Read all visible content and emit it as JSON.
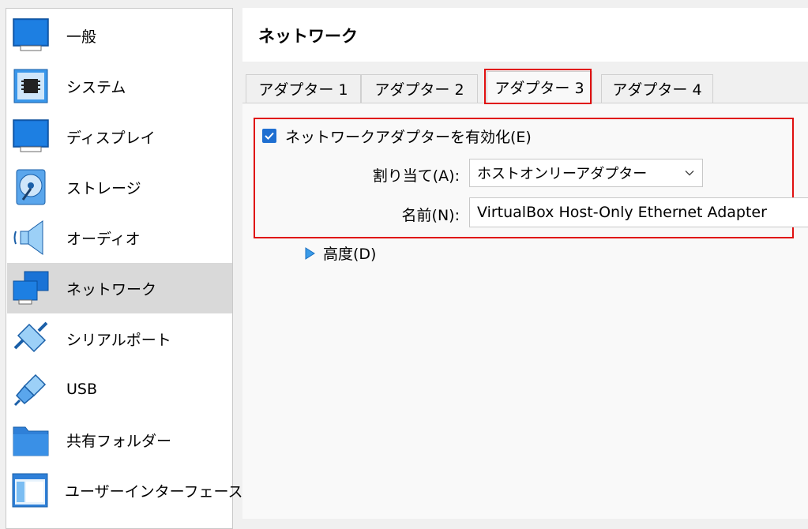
{
  "sidebar": {
    "items": [
      {
        "label": "一般",
        "icon": "general-icon"
      },
      {
        "label": "システム",
        "icon": "system-chip-icon"
      },
      {
        "label": "ディスプレイ",
        "icon": "display-monitor-icon"
      },
      {
        "label": "ストレージ",
        "icon": "storage-disk-icon"
      },
      {
        "label": "オーディオ",
        "icon": "audio-speaker-icon"
      },
      {
        "label": "ネットワーク",
        "icon": "network-icon"
      },
      {
        "label": "シリアルポート",
        "icon": "serial-port-icon"
      },
      {
        "label": "USB",
        "icon": "usb-icon"
      },
      {
        "label": "共有フォルダー",
        "icon": "shared-folder-icon"
      },
      {
        "label": "ユーザーインターフェース",
        "icon": "user-interface-icon"
      }
    ],
    "selected": "ネットワーク"
  },
  "header": {
    "title": "ネットワーク"
  },
  "tabs": [
    {
      "label": "アダプター 1"
    },
    {
      "label": "アダプター 2"
    },
    {
      "label": "アダプター 3"
    },
    {
      "label": "アダプター 4"
    }
  ],
  "active_tab": "アダプター 3",
  "adapter": {
    "enable_label": "ネットワークアダプターを有効化(E)",
    "enabled": true,
    "attached_label": "割り当て(A):",
    "attached_value": "ホストオンリーアダプター",
    "name_label": "名前(N):",
    "name_value": "VirtualBox Host-Only Ethernet Adapter",
    "advanced_label": "高度(D)"
  },
  "colors": {
    "accent": "#1f6fd1",
    "highlight": "#e01010",
    "icon_blue": "#2f80d8"
  }
}
